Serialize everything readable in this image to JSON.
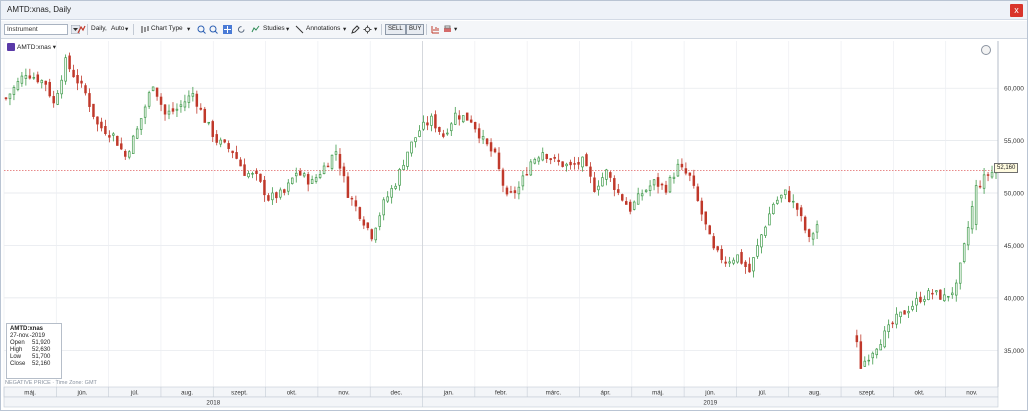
{
  "window": {
    "title": "AMTD:xnas, Daily",
    "close_label": "x"
  },
  "toolbar": {
    "instrument_value": "Instrument",
    "period": "Daily,",
    "auto": "Auto",
    "chart_type": "Chart Type",
    "studies": "Studies",
    "annotations": "Annotations",
    "sell": "SELL",
    "buy": "BUY"
  },
  "legend": {
    "symbol": "AMTD:xnas"
  },
  "info": {
    "symbol": "AMTD:xnas",
    "date": "27-nov.-2019",
    "open_label": "Open",
    "open": "51,920",
    "high_label": "High",
    "high": "52,630",
    "low_label": "Low",
    "low": "51,700",
    "close_label": "Close",
    "close": "52,160"
  },
  "footer": "NEGATIVE PRICE · Time Zone: GMT",
  "last_value": "52,160",
  "chart_data": {
    "type": "candlestick",
    "y_ticks": [
      35000,
      40000,
      45000,
      50000,
      55000,
      60000
    ],
    "y_tick_labels": [
      "35,000",
      "40,000",
      "45,000",
      "50,000",
      "55,000",
      "60,000"
    ],
    "ylim": [
      31500,
      64500
    ],
    "months": [
      "máj.",
      "jún.",
      "júl.",
      "aug.",
      "szept.",
      "okt.",
      "nov.",
      "dec.",
      "jan.",
      "febr.",
      "márc.",
      "ápr.",
      "máj.",
      "jún.",
      "júl.",
      "aug.",
      "szept.",
      "okt.",
      "nov."
    ],
    "years": [
      "2018",
      "2019"
    ],
    "last_close": 52160,
    "close_path": [
      [
        0,
        59000
      ],
      [
        5,
        61500
      ],
      [
        10,
        60500
      ],
      [
        12,
        58500
      ],
      [
        15,
        62500
      ],
      [
        20,
        59500
      ],
      [
        23,
        56500
      ],
      [
        27,
        55500
      ],
      [
        30,
        53500
      ],
      [
        33,
        56000
      ],
      [
        37,
        60500
      ],
      [
        40,
        57500
      ],
      [
        43,
        58000
      ],
      [
        47,
        59500
      ],
      [
        50,
        57000
      ],
      [
        53,
        55000
      ],
      [
        57,
        54000
      ],
      [
        60,
        52000
      ],
      [
        63,
        51500
      ],
      [
        66,
        49500
      ],
      [
        70,
        50000
      ],
      [
        73,
        52000
      ],
      [
        77,
        51000
      ],
      [
        80,
        52500
      ],
      [
        83,
        54000
      ],
      [
        86,
        50000
      ],
      [
        89,
        48000
      ],
      [
        92,
        46000
      ],
      [
        95,
        49000
      ],
      [
        98,
        51000
      ],
      [
        101,
        54000
      ],
      [
        104,
        56000
      ],
      [
        107,
        57000
      ],
      [
        110,
        55500
      ],
      [
        113,
        57500
      ],
      [
        117,
        57000
      ],
      [
        120,
        55000
      ],
      [
        123,
        53500
      ],
      [
        126,
        49500
      ],
      [
        129,
        50500
      ],
      [
        132,
        53000
      ],
      [
        135,
        54000
      ],
      [
        138,
        53000
      ],
      [
        142,
        52500
      ],
      [
        145,
        53000
      ],
      [
        148,
        50500
      ],
      [
        151,
        52000
      ],
      [
        154,
        50000
      ],
      [
        157,
        48500
      ],
      [
        160,
        50000
      ],
      [
        163,
        51000
      ],
      [
        166,
        50500
      ],
      [
        169,
        52500
      ],
      [
        172,
        51500
      ],
      [
        175,
        48000
      ],
      [
        178,
        44500
      ],
      [
        181,
        43500
      ],
      [
        184,
        44000
      ],
      [
        187,
        42500
      ],
      [
        190,
        46000
      ],
      [
        193,
        49000
      ],
      [
        196,
        50000
      ],
      [
        199,
        48500
      ],
      [
        202,
        45500
      ],
      [
        204,
        47000
      ],
      [
        213,
        37500
      ],
      [
        215,
        33500
      ],
      [
        218,
        35000
      ],
      [
        221,
        36500
      ],
      [
        224,
        38000
      ],
      [
        227,
        39000
      ],
      [
        230,
        40000
      ],
      [
        233,
        40500
      ],
      [
        236,
        40000
      ],
      [
        239,
        41000
      ],
      [
        244,
        50500
      ],
      [
        247,
        51800
      ],
      [
        249,
        52160
      ]
    ]
  }
}
